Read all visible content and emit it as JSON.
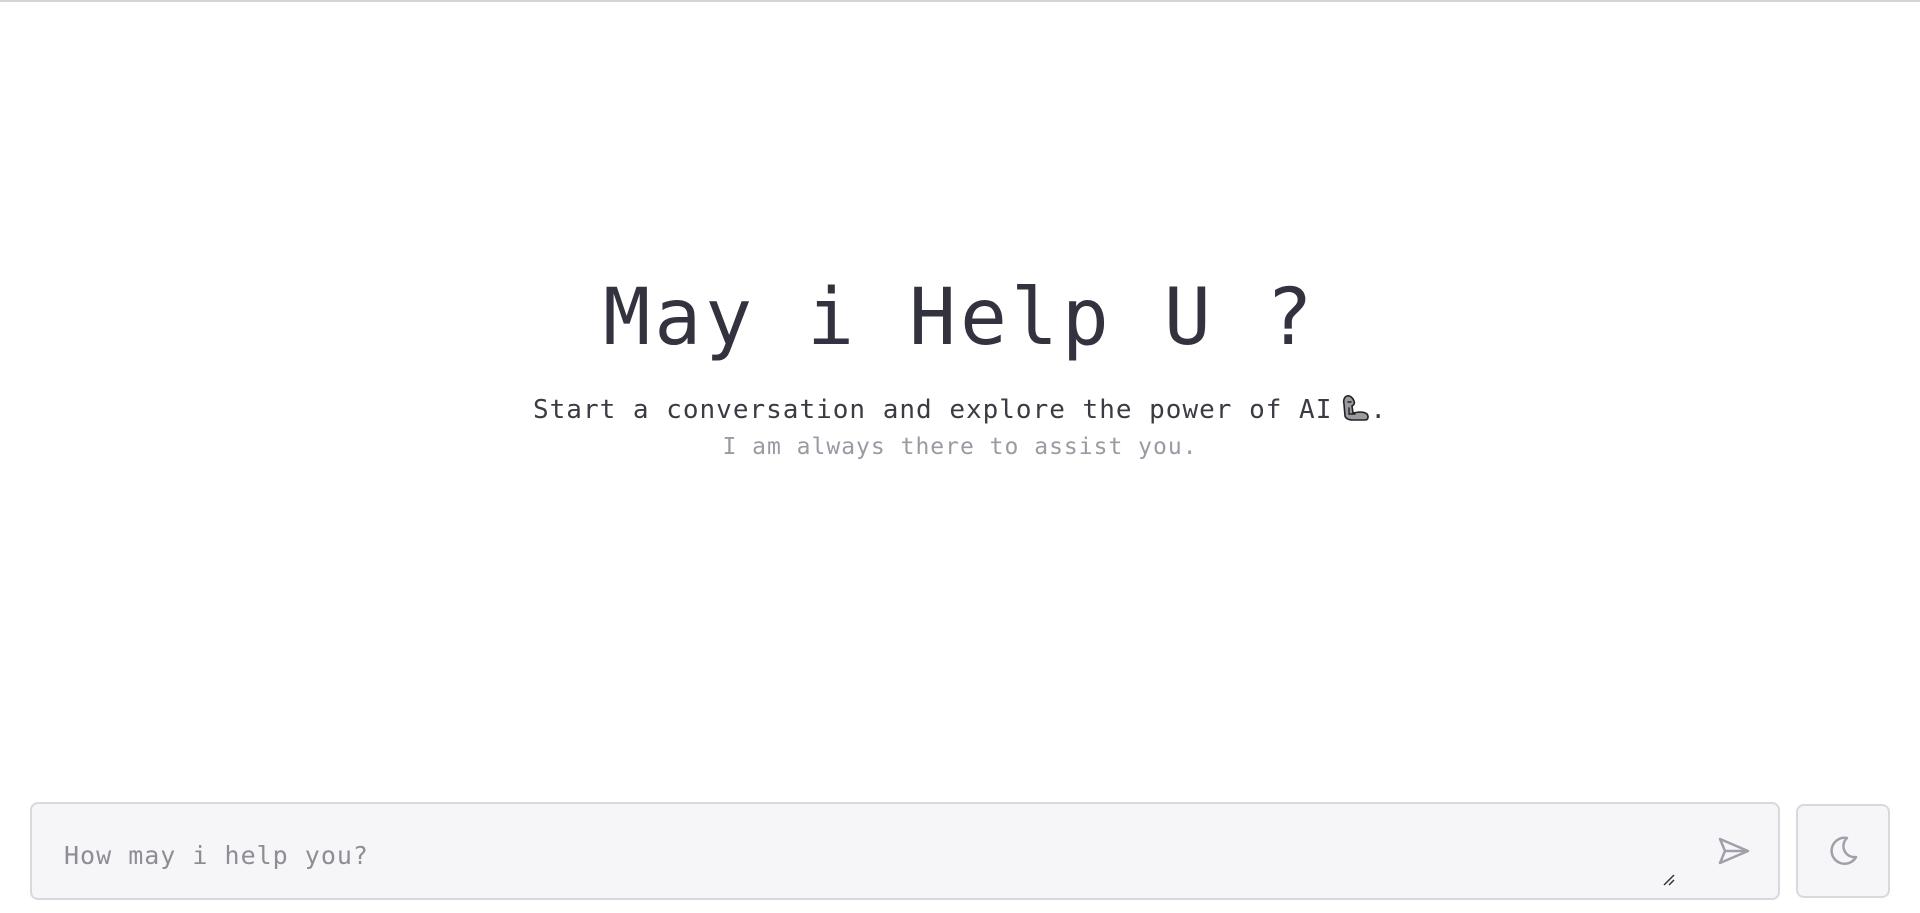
{
  "hero": {
    "title": "May i Help U ?",
    "subtitle": "Start a conversation and explore the power of AI",
    "subtitle_emoji": "flexed-biceps-icon",
    "subtitle_end": ".",
    "note": "I am always there to assist you."
  },
  "composer": {
    "placeholder": "How may i help you?",
    "value": "",
    "send_icon": "send-icon",
    "resize_icon": "resize-handle-icon"
  },
  "theme_toggle": {
    "icon": "moon-icon"
  },
  "colors": {
    "text": "#33333f",
    "muted": "#9a9aa3",
    "input_bg": "#f6f6f8",
    "border": "#d8d8de",
    "icon": "#a0a0ab"
  }
}
